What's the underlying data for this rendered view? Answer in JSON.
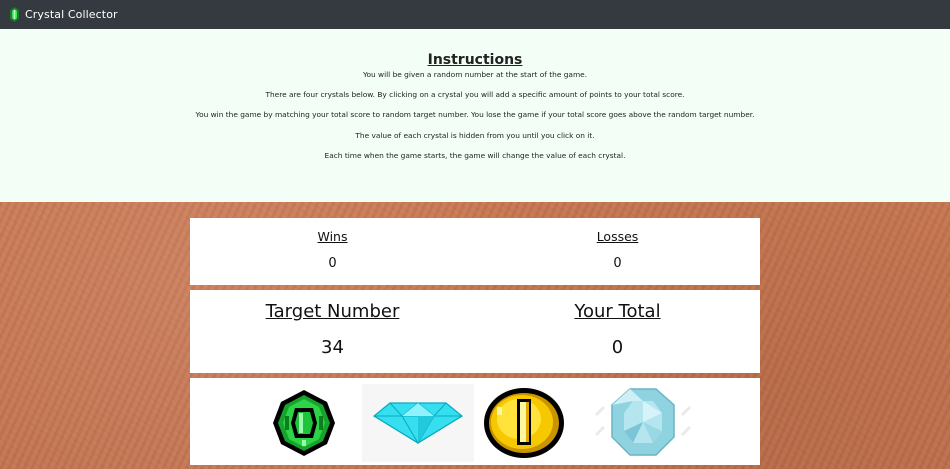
{
  "navbar": {
    "title": "Crystal Collector"
  },
  "instructions": {
    "title": "Instructions",
    "lines": [
      "You will be given a random number at the start of the game.",
      "There are four crystals below. By clicking on a crystal you will add a specific amount of points to your total score.",
      "You win the game by matching your total score to random target number. You lose the game if your total score goes above the random target number.",
      "The value of each crystal is hidden from you until you click on it.",
      "Each time when the game starts, the game will change the value of each crystal."
    ]
  },
  "scoreboard": {
    "wins_label": "Wins",
    "wins_value": "0",
    "losses_label": "Losses",
    "losses_value": "0"
  },
  "game": {
    "target_label": "Target Number",
    "target_value": "34",
    "total_label": "Your Total",
    "total_value": "0"
  },
  "crystals": [
    {
      "icon": "green-emerald-icon",
      "color": "#22c43a"
    },
    {
      "icon": "cyan-diamond-icon",
      "color": "#35dff0"
    },
    {
      "icon": "gold-coin-icon",
      "color": "#f2c200"
    },
    {
      "icon": "blue-gem-icon",
      "color": "#8fd2e0"
    }
  ],
  "colors": {
    "navbar": "#343a40",
    "instructions_bg": "#f3fff6",
    "background_sand": "#c87a55"
  }
}
